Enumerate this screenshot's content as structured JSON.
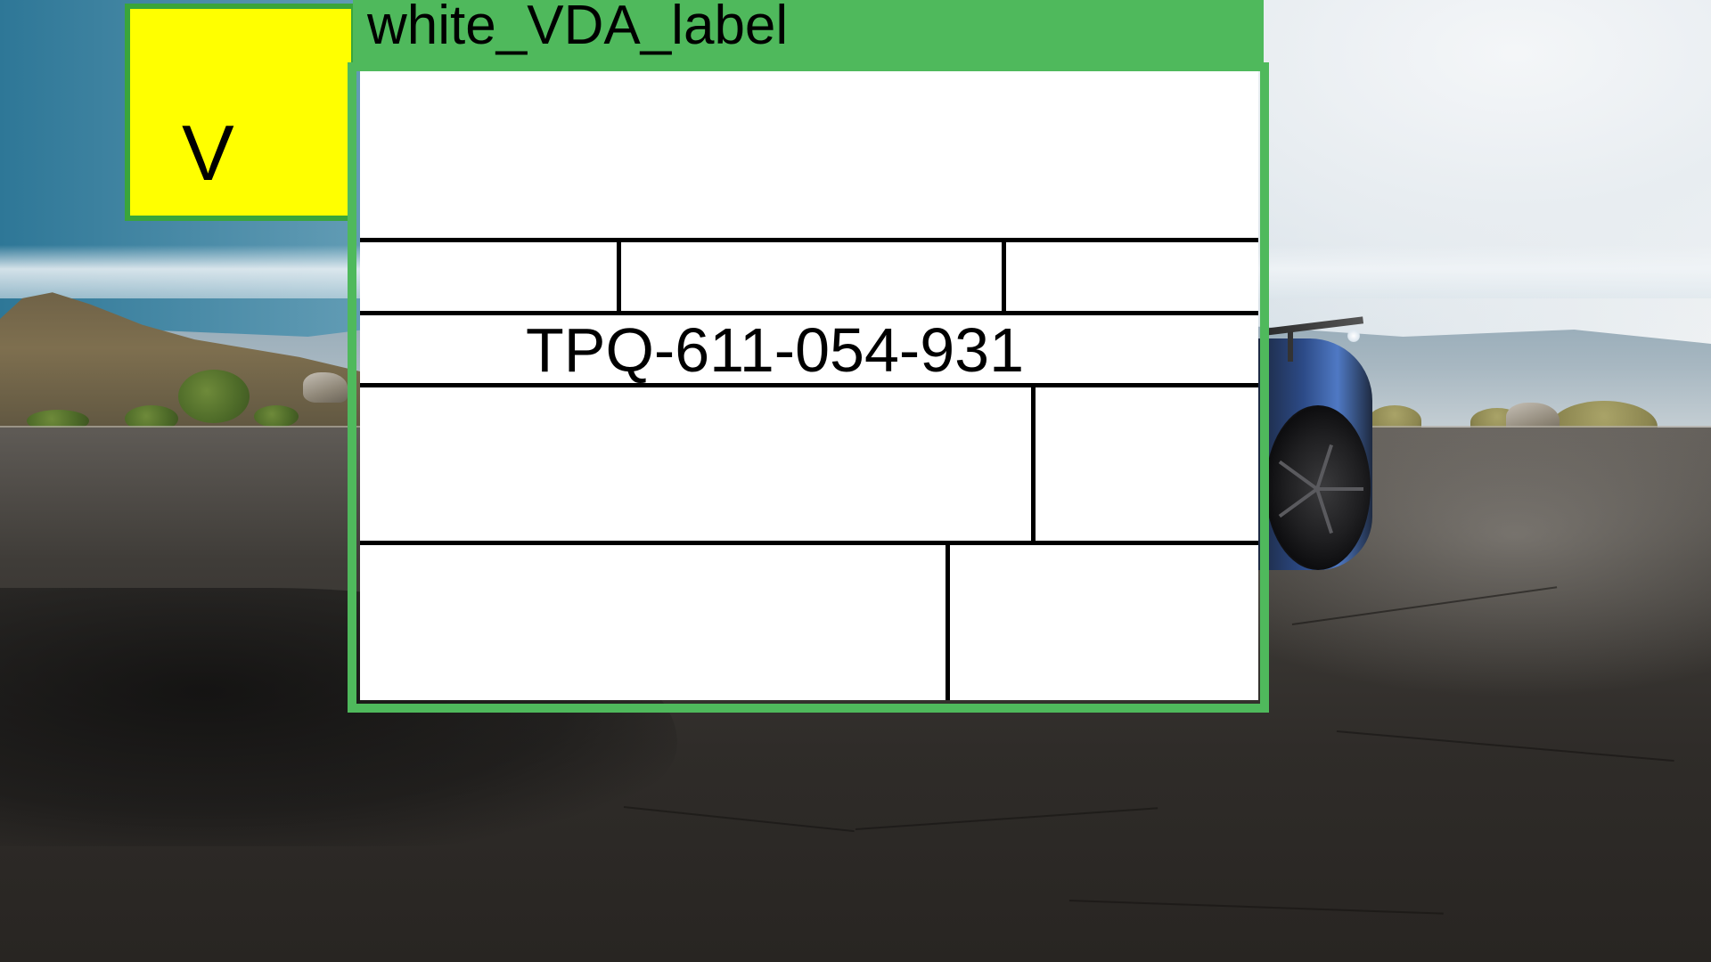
{
  "annotation": {
    "box_label": "white_VDA_label",
    "box_color": "#4fb95c",
    "secondary_box_color": "#ffff00",
    "secondary_box_visible_text": "V"
  },
  "label": {
    "background": "#ffffff",
    "line_color": "#000000",
    "serial_number": "TPQ-611-054-931"
  },
  "background_scene": "sports-car-on-mountain-road-photo"
}
